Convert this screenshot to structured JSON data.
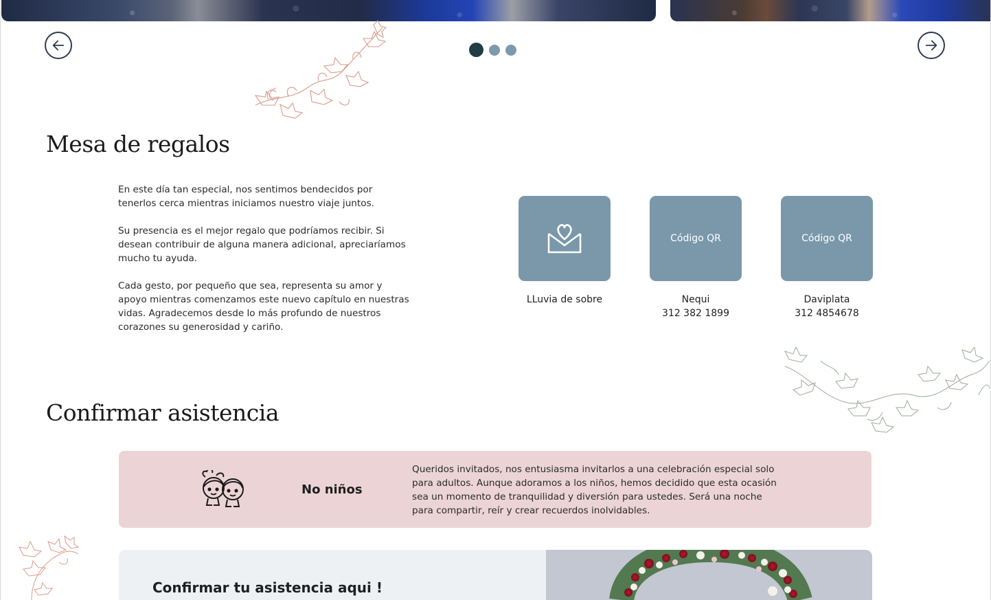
{
  "carousel": {
    "prev_label": "Anterior",
    "next_label": "Siguiente",
    "slides": 3,
    "active_index": 0
  },
  "gifts": {
    "title": "Mesa de regalos",
    "paragraphs": [
      "En este día tan especial, nos sentimos bendecidos por tenerlos cerca mientras iniciamos nuestro viaje juntos.",
      "Su presencia es el mejor regalo que podríamos recibir. Si desean contribuir de alguna manera adicional, apreciaríamos mucho tu ayuda.",
      "Cada gesto, por pequeño que sea, representa su amor y apoyo mientras comenzamos este nuevo capítulo en nuestras vidas. Agradecemos desde lo más profundo de nuestros corazones su generosidad y cariño."
    ],
    "cards": [
      {
        "icon": "heart-envelope-icon",
        "card_text": "",
        "label": "LLuvia de sobre",
        "detail": ""
      },
      {
        "icon": "",
        "card_text": "Código QR",
        "label": "Nequi",
        "detail": "312 382 1899"
      },
      {
        "icon": "",
        "card_text": "Código QR",
        "label": "Daviplata",
        "detail": "312 4854678"
      }
    ]
  },
  "rsvp": {
    "title": "Confirmar asistencia",
    "no_kids": {
      "icon": "children-faces-icon",
      "title": "No niños",
      "text": "Queridos invitados, nos entusiasma invitarlos a una celebración especial solo para adultos. Aunque adoramos a los niños, hemos decidido que esta ocasión sea un momento de tranquilidad y diversión para ustedes. Será una noche para compartir, reír y crear recuerdos inolvidables."
    },
    "cta": "Confirmar tu asistencia aqui !"
  },
  "colors": {
    "accent": "#7a98aa",
    "dot_active": "#203c44",
    "banner_pink": "#ecd4d6",
    "panel_gray": "#edf1f4",
    "vine_rose": "#d99a88",
    "vine_sage": "#9aa99a"
  }
}
